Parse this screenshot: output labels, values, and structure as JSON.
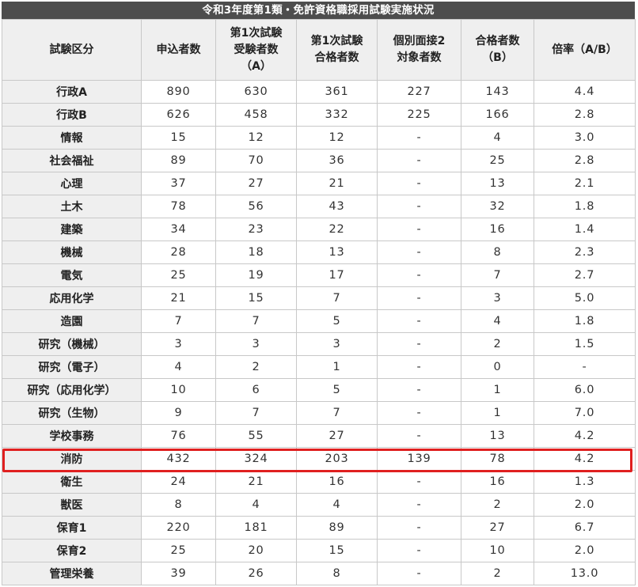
{
  "title": "令和3年度第1類・免許資格職採用試験実施状況",
  "headers": [
    [
      "試験区分"
    ],
    [
      "申込者数"
    ],
    [
      "第1次試験",
      "受験者数",
      "（A）"
    ],
    [
      "第1次試験",
      "合格者数"
    ],
    [
      "個別面接2",
      "対象者数"
    ],
    [
      "合格者数",
      "（B）"
    ],
    [
      "倍率（A/B）"
    ]
  ],
  "rows": [
    [
      "行政A",
      "890",
      "630",
      "361",
      "227",
      "143",
      "4.4"
    ],
    [
      "行政B",
      "626",
      "458",
      "332",
      "225",
      "166",
      "2.8"
    ],
    [
      "情報",
      "15",
      "12",
      "12",
      "-",
      "4",
      "3.0"
    ],
    [
      "社会福祉",
      "89",
      "70",
      "36",
      "-",
      "25",
      "2.8"
    ],
    [
      "心理",
      "37",
      "27",
      "21",
      "-",
      "13",
      "2.1"
    ],
    [
      "土木",
      "78",
      "56",
      "43",
      "-",
      "32",
      "1.8"
    ],
    [
      "建築",
      "34",
      "23",
      "22",
      "-",
      "16",
      "1.4"
    ],
    [
      "機械",
      "28",
      "18",
      "13",
      "-",
      "8",
      "2.3"
    ],
    [
      "電気",
      "25",
      "19",
      "17",
      "-",
      "7",
      "2.7"
    ],
    [
      "応用化学",
      "21",
      "15",
      "7",
      "-",
      "3",
      "5.0"
    ],
    [
      "造園",
      "7",
      "7",
      "5",
      "-",
      "4",
      "1.8"
    ],
    [
      "研究（機械）",
      "3",
      "3",
      "3",
      "-",
      "2",
      "1.5"
    ],
    [
      "研究（電子）",
      "4",
      "2",
      "1",
      "-",
      "0",
      "-"
    ],
    [
      "研究（応用化学）",
      "10",
      "6",
      "5",
      "-",
      "1",
      "6.0"
    ],
    [
      "研究（生物）",
      "9",
      "7",
      "7",
      "-",
      "1",
      "7.0"
    ],
    [
      "学校事務",
      "76",
      "55",
      "27",
      "-",
      "13",
      "4.2"
    ],
    [
      "消防",
      "432",
      "324",
      "203",
      "139",
      "78",
      "4.2"
    ],
    [
      "衛生",
      "24",
      "21",
      "16",
      "-",
      "16",
      "1.3"
    ],
    [
      "獣医",
      "8",
      "4",
      "4",
      "-",
      "2",
      "2.0"
    ],
    [
      "保育1",
      "220",
      "181",
      "89",
      "-",
      "27",
      "6.7"
    ],
    [
      "保育2",
      "25",
      "20",
      "15",
      "-",
      "10",
      "2.0"
    ],
    [
      "管理栄養",
      "39",
      "26",
      "8",
      "-",
      "2",
      "13.0"
    ]
  ],
  "highlight_row": 16,
  "colors": {
    "title_bg": "#4d4d4d",
    "header_bg": "#efefef",
    "highlight": "#e02020"
  }
}
